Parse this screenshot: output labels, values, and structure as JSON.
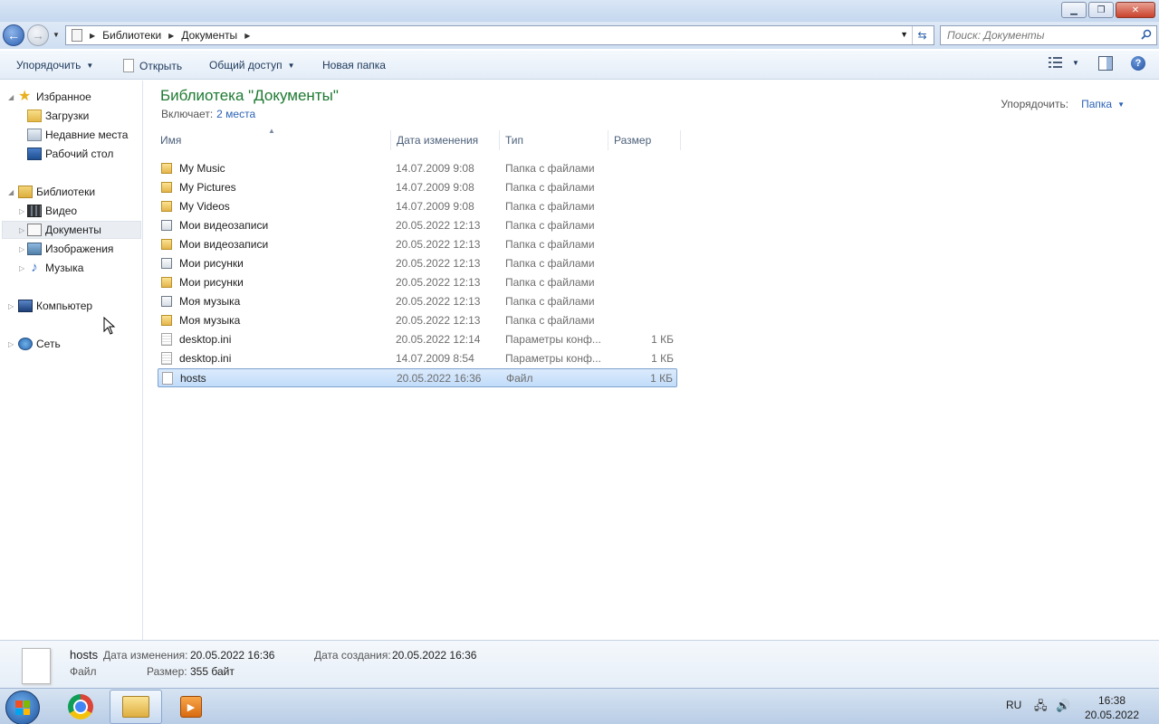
{
  "address": {
    "crumbs": [
      "Библиотеки",
      "Документы"
    ],
    "search_placeholder": "Поиск: Документы"
  },
  "toolbar": {
    "organize": "Упорядочить",
    "open": "Открыть",
    "share": "Общий доступ",
    "new_folder": "Новая папка"
  },
  "nav": {
    "favorites": "Избранное",
    "downloads": "Загрузки",
    "recent": "Недавние места",
    "desktop": "Рабочий стол",
    "libraries": "Библиотеки",
    "video": "Видео",
    "documents": "Документы",
    "images": "Изображения",
    "music": "Музыка",
    "computer": "Компьютер",
    "network": "Сеть"
  },
  "library": {
    "title": "Библиотека \"Документы\"",
    "includes_label": "Включает:",
    "includes_link": "2 места",
    "arrange_label": "Упорядочить:",
    "arrange_value": "Папка"
  },
  "columns": {
    "name": "Имя",
    "date": "Дата изменения",
    "type": "Тип",
    "size": "Размер"
  },
  "files": [
    {
      "name": "My Music",
      "date": "14.07.2009 9:08",
      "type": "Папка с файлами",
      "size": "",
      "icon": "folder-lock-icon"
    },
    {
      "name": "My Pictures",
      "date": "14.07.2009 9:08",
      "type": "Папка с файлами",
      "size": "",
      "icon": "folder-lock-icon"
    },
    {
      "name": "My Videos",
      "date": "14.07.2009 9:08",
      "type": "Папка с файлами",
      "size": "",
      "icon": "folder-lock-icon"
    },
    {
      "name": "Мои видеозаписи",
      "date": "20.05.2022 12:13",
      "type": "Папка с файлами",
      "size": "",
      "icon": "shortcut-icon"
    },
    {
      "name": "Мои видеозаписи",
      "date": "20.05.2022 12:13",
      "type": "Папка с файлами",
      "size": "",
      "icon": "folder-lock-icon"
    },
    {
      "name": "Мои рисунки",
      "date": "20.05.2022 12:13",
      "type": "Папка с файлами",
      "size": "",
      "icon": "shortcut-icon"
    },
    {
      "name": "Мои рисунки",
      "date": "20.05.2022 12:13",
      "type": "Папка с файлами",
      "size": "",
      "icon": "folder-lock-icon"
    },
    {
      "name": "Моя музыка",
      "date": "20.05.2022 12:13",
      "type": "Папка с файлами",
      "size": "",
      "icon": "shortcut-icon"
    },
    {
      "name": "Моя музыка",
      "date": "20.05.2022 12:13",
      "type": "Папка с файлами",
      "size": "",
      "icon": "folder-lock-icon"
    },
    {
      "name": "desktop.ini",
      "date": "20.05.2022 12:14",
      "type": "Параметры конф...",
      "size": "1 КБ",
      "icon": "ini-file-icon"
    },
    {
      "name": "desktop.ini",
      "date": "14.07.2009 8:54",
      "type": "Параметры конф...",
      "size": "1 КБ",
      "icon": "ini-file-icon"
    },
    {
      "name": "hosts",
      "date": "20.05.2022 16:36",
      "type": "Файл",
      "size": "1 КБ",
      "icon": "file-icon",
      "selected": true
    }
  ],
  "details": {
    "name": "hosts",
    "type": "Файл",
    "modified_label": "Дата изменения:",
    "modified_value": "20.05.2022 16:36",
    "created_label": "Дата создания:",
    "created_value": "20.05.2022 16:36",
    "size_label": "Размер:",
    "size_value": "355 байт"
  },
  "taskbar": {
    "lang": "RU",
    "time": "16:38",
    "date": "20.05.2022"
  }
}
